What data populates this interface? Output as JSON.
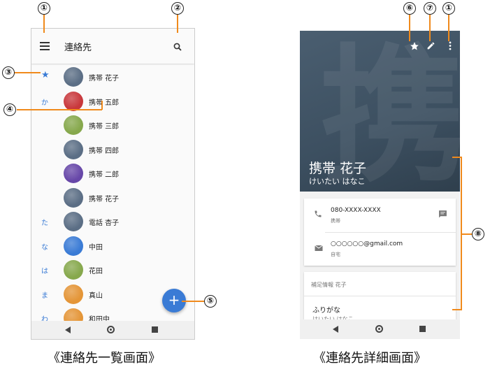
{
  "left": {
    "title": "連絡先",
    "contacts": [
      {
        "index": "★",
        "name": "携帯 花子",
        "color": "#5b6e85"
      },
      {
        "index": "か",
        "name": "携帯 五郎",
        "color": "#c8373b"
      },
      {
        "index": "",
        "name": "携帯 三郎",
        "color": "#86a84c"
      },
      {
        "index": "",
        "name": "携帯 四郎",
        "color": "#5b6e85"
      },
      {
        "index": "",
        "name": "携帯 二郎",
        "color": "#6747a8"
      },
      {
        "index": "",
        "name": "携帯 花子",
        "color": "#5b6e85"
      },
      {
        "index": "た",
        "name": "電話 杏子",
        "color": "#5b6e85"
      },
      {
        "index": "な",
        "name": "中田",
        "color": "#3a7bd5"
      },
      {
        "index": "は",
        "name": "花田",
        "color": "#86a84c"
      },
      {
        "index": "ま",
        "name": "真山",
        "color": "#e49537"
      },
      {
        "index": "わ",
        "name": "和田中",
        "color": "#e49537"
      }
    ],
    "fab_label": "+",
    "caption": "《連絡先一覧画面》"
  },
  "right": {
    "name": "携帯 花子",
    "kana": "けいたい はなこ",
    "hero_glyph": "携",
    "phone_number": "080-XXXX-XXXX",
    "phone_type": "携帯",
    "email": "○○○○○○@gmail.com",
    "email_type": "自宅",
    "extra_header": "補足情報 花子",
    "furigana_label": "ふりがな",
    "furigana_value": "けいたい はなこ",
    "caption": "《連絡先詳細画面》"
  },
  "callouts": {
    "c1": "①",
    "c2": "②",
    "c3": "③",
    "c4": "④",
    "c5": "⑤",
    "c6": "⑥",
    "c7": "⑦",
    "c8": "①",
    "c9": "⑧"
  },
  "colors": {
    "accent": "#3a7bd5",
    "callout_line": "#f08a1c"
  }
}
